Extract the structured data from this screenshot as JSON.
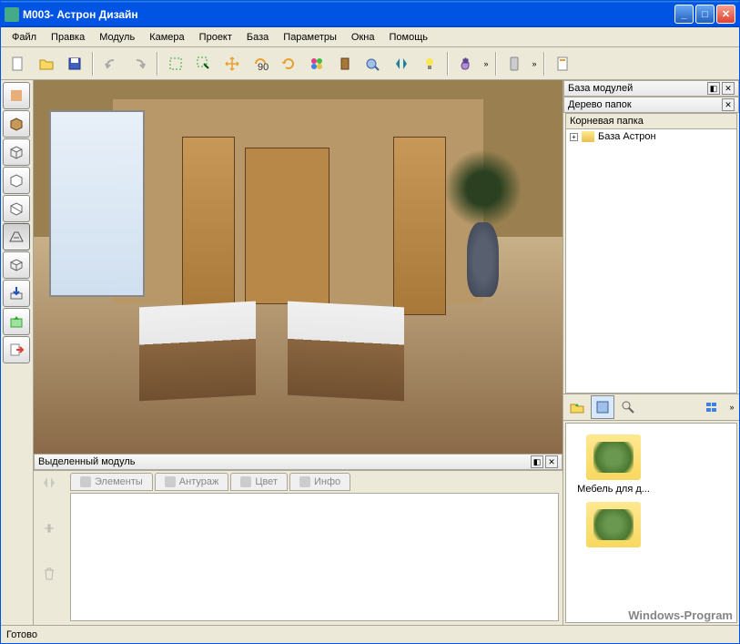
{
  "title": "М003- Астрон Дизайн",
  "menu": [
    "Файл",
    "Правка",
    "Модуль",
    "Камера",
    "Проект",
    "База",
    "Параметры",
    "Окна",
    "Помощь"
  ],
  "toolbar_icons": [
    "new",
    "open",
    "save",
    "undo",
    "redo",
    "select-rect",
    "select-cursor",
    "move",
    "rotate-90",
    "rotate",
    "flower",
    "door",
    "view",
    "mirror",
    "bulb",
    "hand",
    "phone",
    "doc"
  ],
  "panels": {
    "module_base": "База модулей",
    "folder_tree": "Дерево папок",
    "root_folder": "Корневая папка",
    "astron_base": "База Астрон",
    "selected_module": "Выделенный модуль"
  },
  "tabs": {
    "elements": "Элементы",
    "entourage": "Антураж",
    "color": "Цвет",
    "info": "Инфо"
  },
  "browser": {
    "item1": "Мебель для д..."
  },
  "status": "Готово",
  "watermark": "Windows-Program"
}
